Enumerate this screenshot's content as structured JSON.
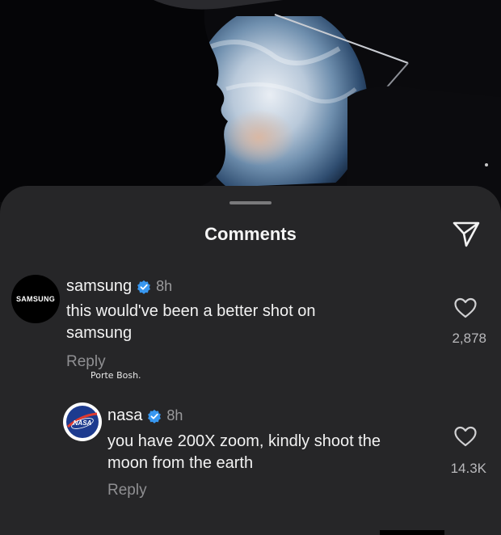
{
  "sheet": {
    "title": "Comments",
    "share_icon": "send-icon"
  },
  "comments": [
    {
      "avatar_text": "SAMSUNG",
      "username": "samsung",
      "verified": true,
      "time": "8h",
      "text_lines": [
        "this would've been a better shot on",
        "samsung"
      ],
      "reply_label": "Reply",
      "likes": "2,878"
    },
    {
      "avatar_text": "NASA",
      "username": "nasa",
      "verified": true,
      "time": "8h",
      "text_lines": [
        "you have 200X zoom, kindly shoot the",
        "moon from the earth"
      ],
      "reply_label": "Reply",
      "likes": "14.3K"
    }
  ],
  "watermark": "Porte Bosh.",
  "colors": {
    "sheet_bg": "#262628",
    "verified_blue": "#3897f0",
    "muted_text": "#8f8f92"
  }
}
